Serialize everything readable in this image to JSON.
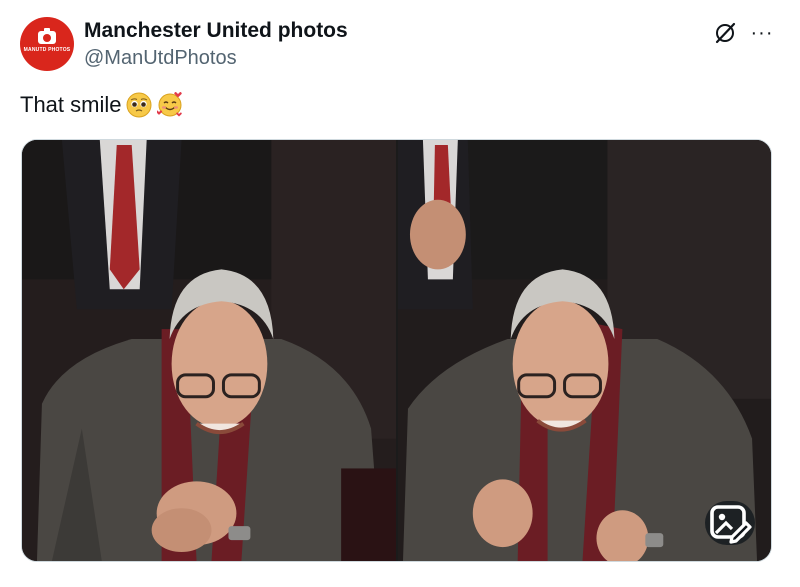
{
  "author": {
    "display_name": "Manchester United photos",
    "handle": "@ManUtdPhotos",
    "avatar_icon": "camera-logo-icon",
    "avatar_text": "MANUTD PHOTOS",
    "avatar_color": "#d9261c"
  },
  "header_actions": {
    "grok_icon": "grok-icon",
    "more_icon": "more-icon",
    "more_label": "···"
  },
  "tweet": {
    "text": "That smile",
    "emojis": [
      "pleading-face-emoji",
      "smiling-face-with-hearts-emoji"
    ]
  },
  "media": {
    "photos": [
      {
        "subject": "elderly man in dark coat and maroon scarf clapping, smiling"
      },
      {
        "subject": "elderly man in dark coat and maroon scarf fist-pumping, smiling"
      }
    ],
    "edit_icon": "photo-edit-icon"
  },
  "colors": {
    "text_primary": "#0f1419",
    "text_secondary": "#536471",
    "border": "#cfd9de"
  }
}
